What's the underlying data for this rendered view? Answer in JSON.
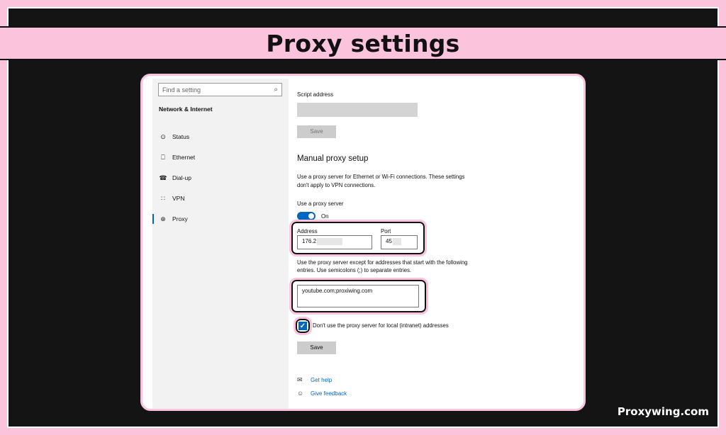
{
  "banner": {
    "title": "Proxy settings"
  },
  "watermark": "Proxywing.com",
  "sidebar": {
    "search_placeholder": "Find a setting",
    "section_title": "Network & Internet",
    "items": [
      {
        "label": "Status",
        "icon": "status-icon"
      },
      {
        "label": "Ethernet",
        "icon": "ethernet-icon"
      },
      {
        "label": "Dial-up",
        "icon": "dial-up-icon"
      },
      {
        "label": "VPN",
        "icon": "vpn-icon"
      },
      {
        "label": "Proxy",
        "icon": "globe-icon",
        "active": true
      }
    ]
  },
  "main": {
    "script_address_label": "Script address",
    "save_label_1": "Save",
    "manual_heading": "Manual proxy setup",
    "manual_desc_line1": "Use a proxy server for Ethernet or Wi-Fi connections. These settings",
    "manual_desc_line2": "don't apply to VPN connections.",
    "use_proxy_label": "Use a proxy server",
    "toggle_state": "On",
    "address_label": "Address",
    "address_value": "176.2",
    "port_label": "Port",
    "port_value": "45",
    "exceptions_line1": "Use the proxy server except for addresses that start with the following",
    "exceptions_line2": "entries. Use semicolons (;) to separate entries.",
    "exceptions_value": "youtube.com;proxiwing.com",
    "local_checkbox_label": "Don't use the proxy server for local (intranet) addresses",
    "local_checkbox_checked": true,
    "save_label_2": "Save",
    "get_help": "Get help",
    "give_feedback": "Give feedback"
  },
  "colors": {
    "accent": "#0067c0",
    "highlight_pink": "#fcc3dd",
    "background_dark": "#141414"
  }
}
